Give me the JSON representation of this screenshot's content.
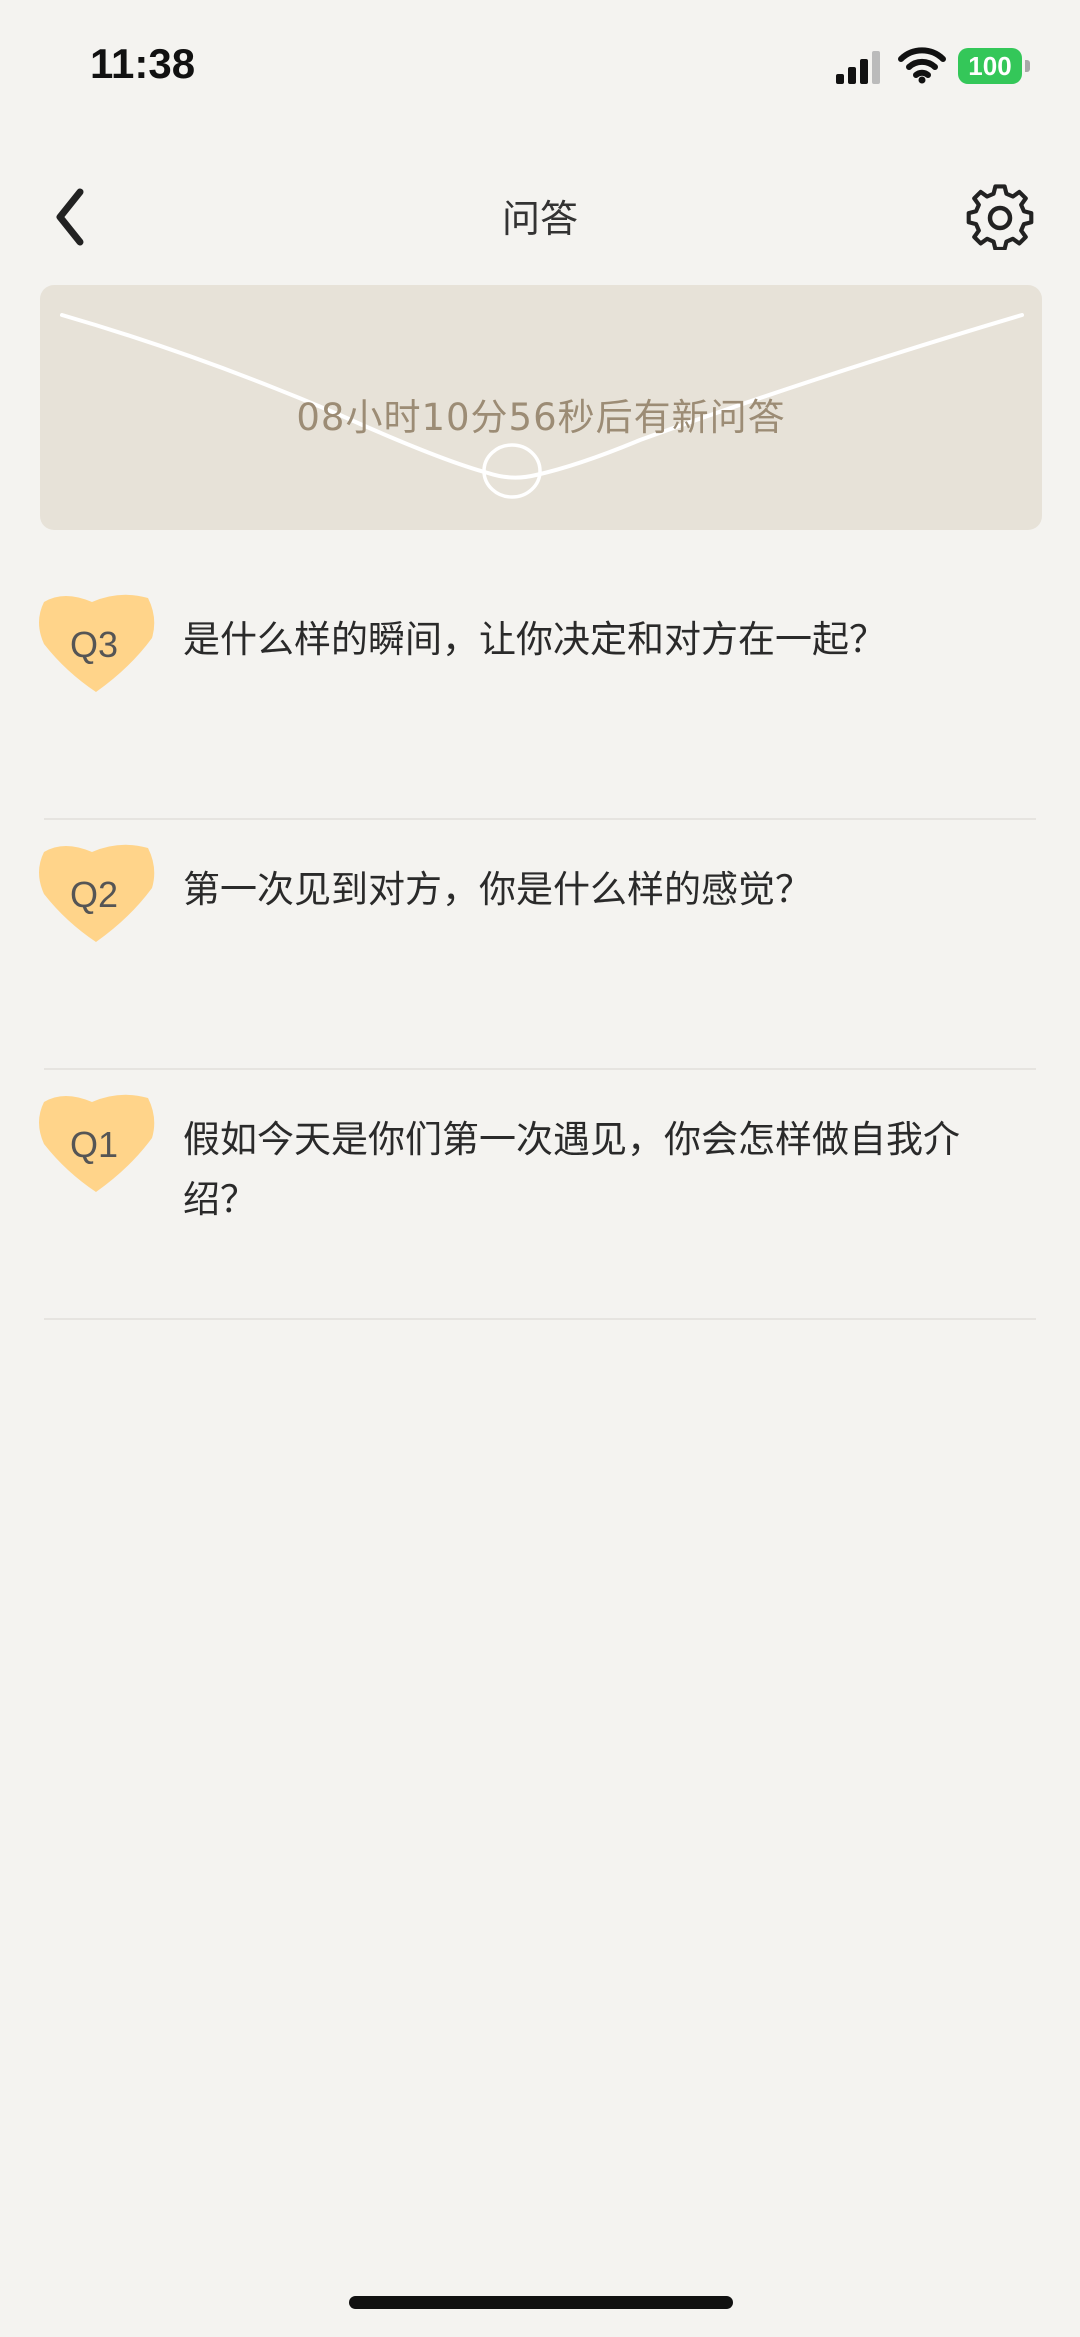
{
  "status_bar": {
    "time": "11:38",
    "battery": "100",
    "signal_icon": "cellular-signal-icon",
    "wifi_icon": "wifi-icon",
    "battery_color": "#34c759"
  },
  "header": {
    "title": "问答",
    "back_icon": "chevron-left-icon",
    "settings_icon": "gear-icon"
  },
  "banner": {
    "countdown_text": "08小时10分56秒后有新问答",
    "background_color": "#e7e2d8",
    "text_color": "#9c8c75"
  },
  "questions": [
    {
      "label": "Q3",
      "text": "是什么样的瞬间，让你决定和对方在一起？"
    },
    {
      "label": "Q2",
      "text": "第一次见到对方，你是什么样的感觉？"
    },
    {
      "label": "Q1",
      "text": "假如今天是你们第一次遇见，你会怎样做自我介绍？"
    }
  ],
  "badge_color": "#ffd48a"
}
